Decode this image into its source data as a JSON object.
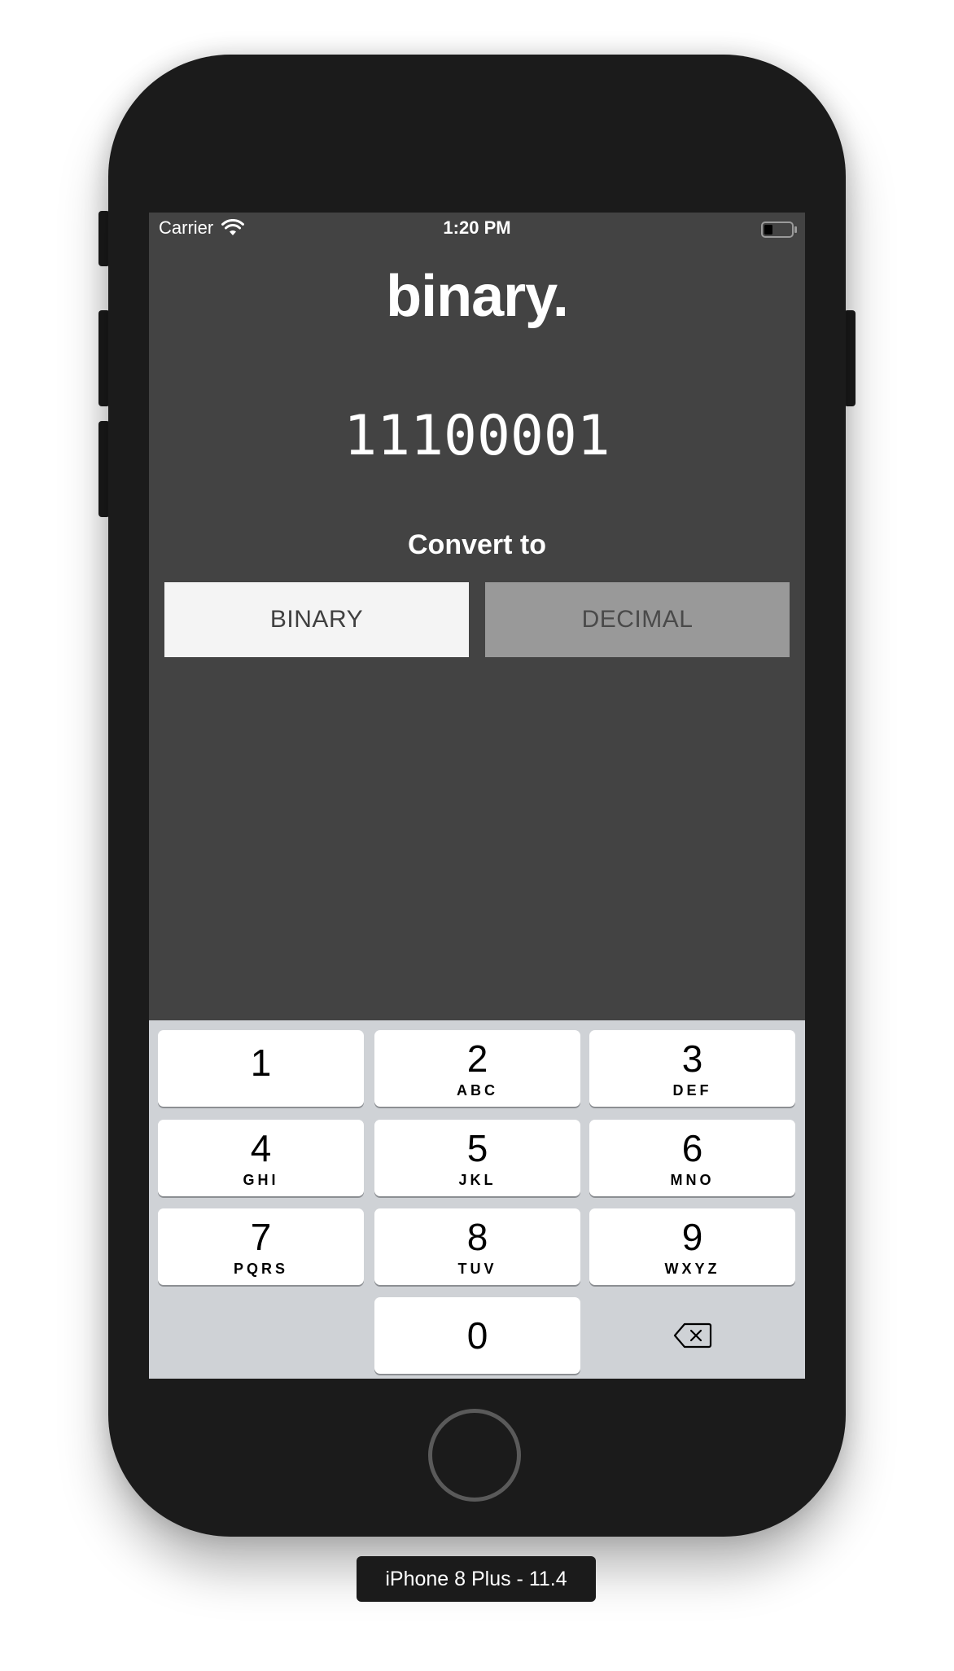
{
  "status_bar": {
    "carrier": "Carrier",
    "time": "1:20 PM"
  },
  "app": {
    "title": "binary.",
    "display_value": "11100001",
    "convert_label": "Convert to",
    "options": [
      {
        "label": "BINARY",
        "selected": true
      },
      {
        "label": "DECIMAL",
        "selected": false
      }
    ]
  },
  "keypad": {
    "keys": [
      {
        "digit": "1",
        "letters": ""
      },
      {
        "digit": "2",
        "letters": "ABC"
      },
      {
        "digit": "3",
        "letters": "DEF"
      },
      {
        "digit": "4",
        "letters": "GHI"
      },
      {
        "digit": "5",
        "letters": "JKL"
      },
      {
        "digit": "6",
        "letters": "MNO"
      },
      {
        "digit": "7",
        "letters": "PQRS"
      },
      {
        "digit": "8",
        "letters": "TUV"
      },
      {
        "digit": "9",
        "letters": "WXYZ"
      },
      {
        "digit": "0",
        "letters": ""
      }
    ],
    "delete_icon": "backspace-icon"
  },
  "simulator": {
    "device_label": "iPhone 8 Plus - 11.4"
  },
  "colors": {
    "screen_background": "#434343",
    "selected_option": "#f4f4f4",
    "unselected_option": "#999999",
    "keypad_background": "#cfd2d6"
  }
}
